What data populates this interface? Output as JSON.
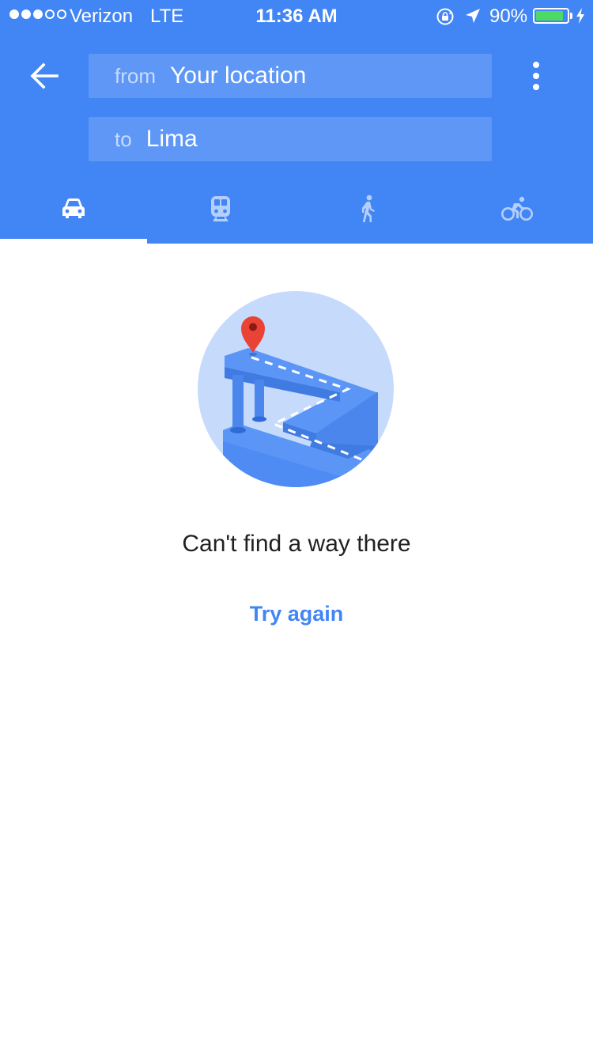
{
  "status_bar": {
    "carrier": "Verizon",
    "network": "LTE",
    "time": "11:36 AM",
    "battery_percent": "90%",
    "battery_level": 0.9,
    "signal_bars_filled": 3,
    "signal_bars_total": 5
  },
  "header": {
    "back_icon": "arrow-left-icon",
    "menu_icon": "more-vert-icon",
    "from_prefix": "from",
    "from_value": "Your location",
    "to_prefix": "to",
    "to_value": "Lima"
  },
  "tabs": [
    {
      "icon": "car-icon",
      "selected": true
    },
    {
      "icon": "train-icon",
      "selected": false
    },
    {
      "icon": "walk-icon",
      "selected": false
    },
    {
      "icon": "bike-icon",
      "selected": false
    }
  ],
  "content": {
    "illustration_icon": "route-illustration",
    "message": "Can't find a way there",
    "action_label": "Try again"
  },
  "colors": {
    "primary": "#4285f4",
    "field_bg": "#5e97f6",
    "tab_inactive": "#b4cffb",
    "battery": "#4cd964",
    "pin": "#ea4335"
  }
}
